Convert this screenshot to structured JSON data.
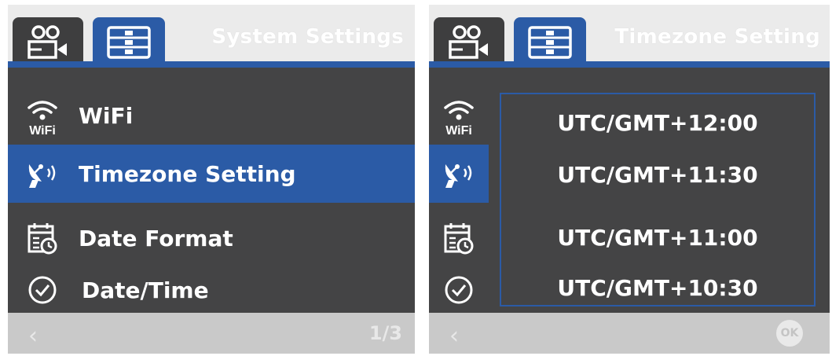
{
  "left_screen": {
    "title": "System Settings",
    "menu": [
      {
        "icon": "wifi-icon",
        "icon_text": "WiFi",
        "label": "WiFi",
        "selected": false
      },
      {
        "icon": "satellite-dish-icon",
        "label": "Timezone Setting",
        "selected": true
      },
      {
        "icon": "calendar-clock-icon",
        "label": "Date Format",
        "selected": false
      },
      {
        "icon": "clock-check-icon",
        "label": "Date/Time",
        "selected": false
      }
    ],
    "footer": {
      "back": "‹",
      "page_indicator": "1/3"
    }
  },
  "right_screen": {
    "title": "Timezone Setting",
    "icon_column": [
      {
        "icon": "wifi-icon",
        "icon_text": "WiFi",
        "selected": false
      },
      {
        "icon": "satellite-dish-icon",
        "selected": true
      },
      {
        "icon": "calendar-clock-icon",
        "selected": false
      },
      {
        "icon": "clock-check-icon",
        "selected": false
      }
    ],
    "timezone_options": [
      "UTC/GMT+12:00",
      "UTC/GMT+11:30",
      "UTC/GMT+11:00",
      "UTC/GMT+10:30"
    ],
    "footer": {
      "back": "‹",
      "ok_label": "OK"
    }
  },
  "colors": {
    "accent": "#2b5ba6",
    "panel": "#444445",
    "header": "#ebebeb",
    "footer": "#c9c9c9"
  }
}
